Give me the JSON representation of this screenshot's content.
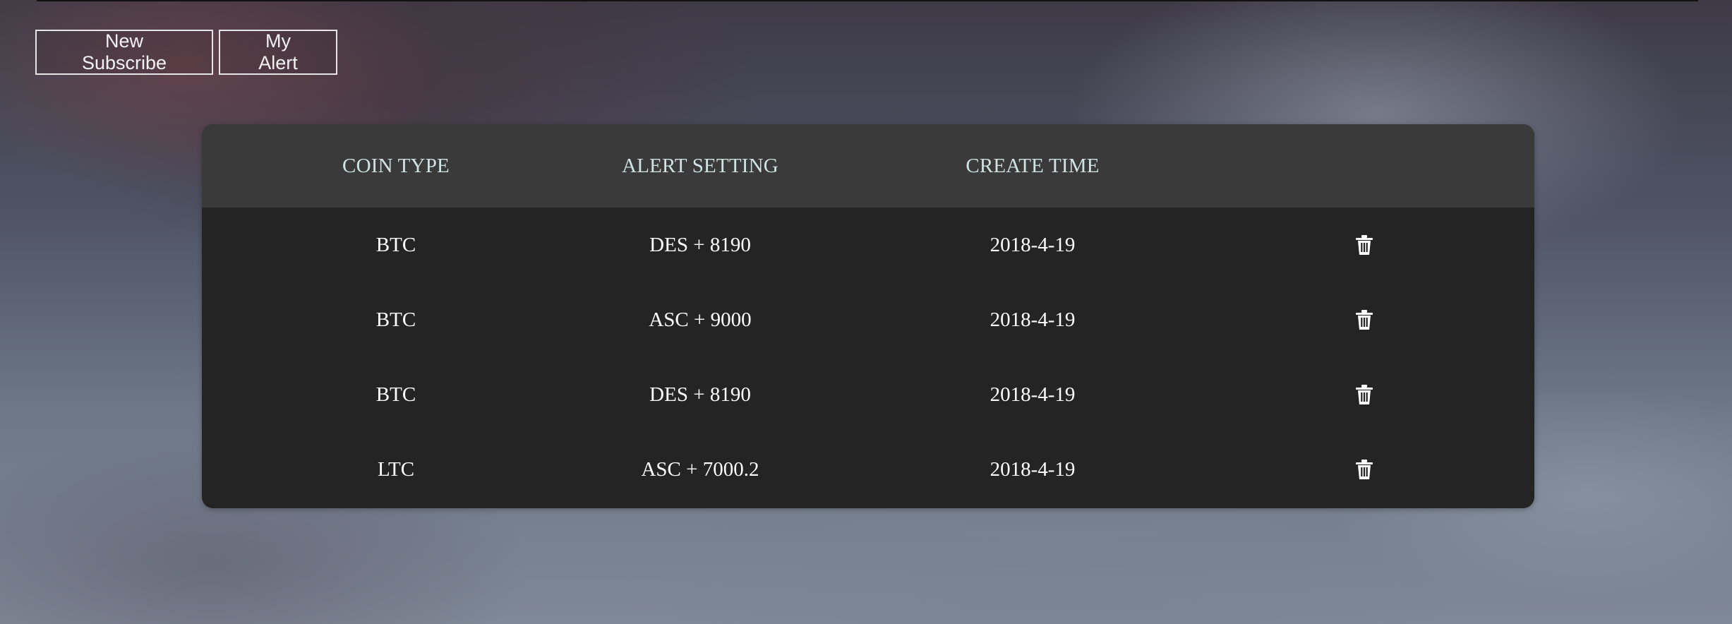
{
  "toolbar": {
    "new_subscribe_label": "New Subscribe",
    "my_alert_label": "My Alert"
  },
  "table": {
    "columns": [
      "COIN TYPE",
      "ALERT SETTING",
      "CREATE TIME",
      ""
    ],
    "rows": [
      {
        "coin": "BTC",
        "setting": "DES + 8190",
        "time": "2018-4-19",
        "action_icon": "trash-icon"
      },
      {
        "coin": "BTC",
        "setting": "ASC + 9000",
        "time": "2018-4-19",
        "action_icon": "trash-icon"
      },
      {
        "coin": "BTC",
        "setting": "DES + 8190",
        "time": "2018-4-19",
        "action_icon": "trash-icon"
      },
      {
        "coin": "LTC",
        "setting": "ASC + 7000.2",
        "time": "2018-4-19",
        "action_icon": "trash-icon"
      }
    ]
  },
  "colors": {
    "header_bg": "#3a3a3a",
    "body_bg": "#242424",
    "header_text": "#cfe3e3",
    "body_text": "#ffffff"
  }
}
